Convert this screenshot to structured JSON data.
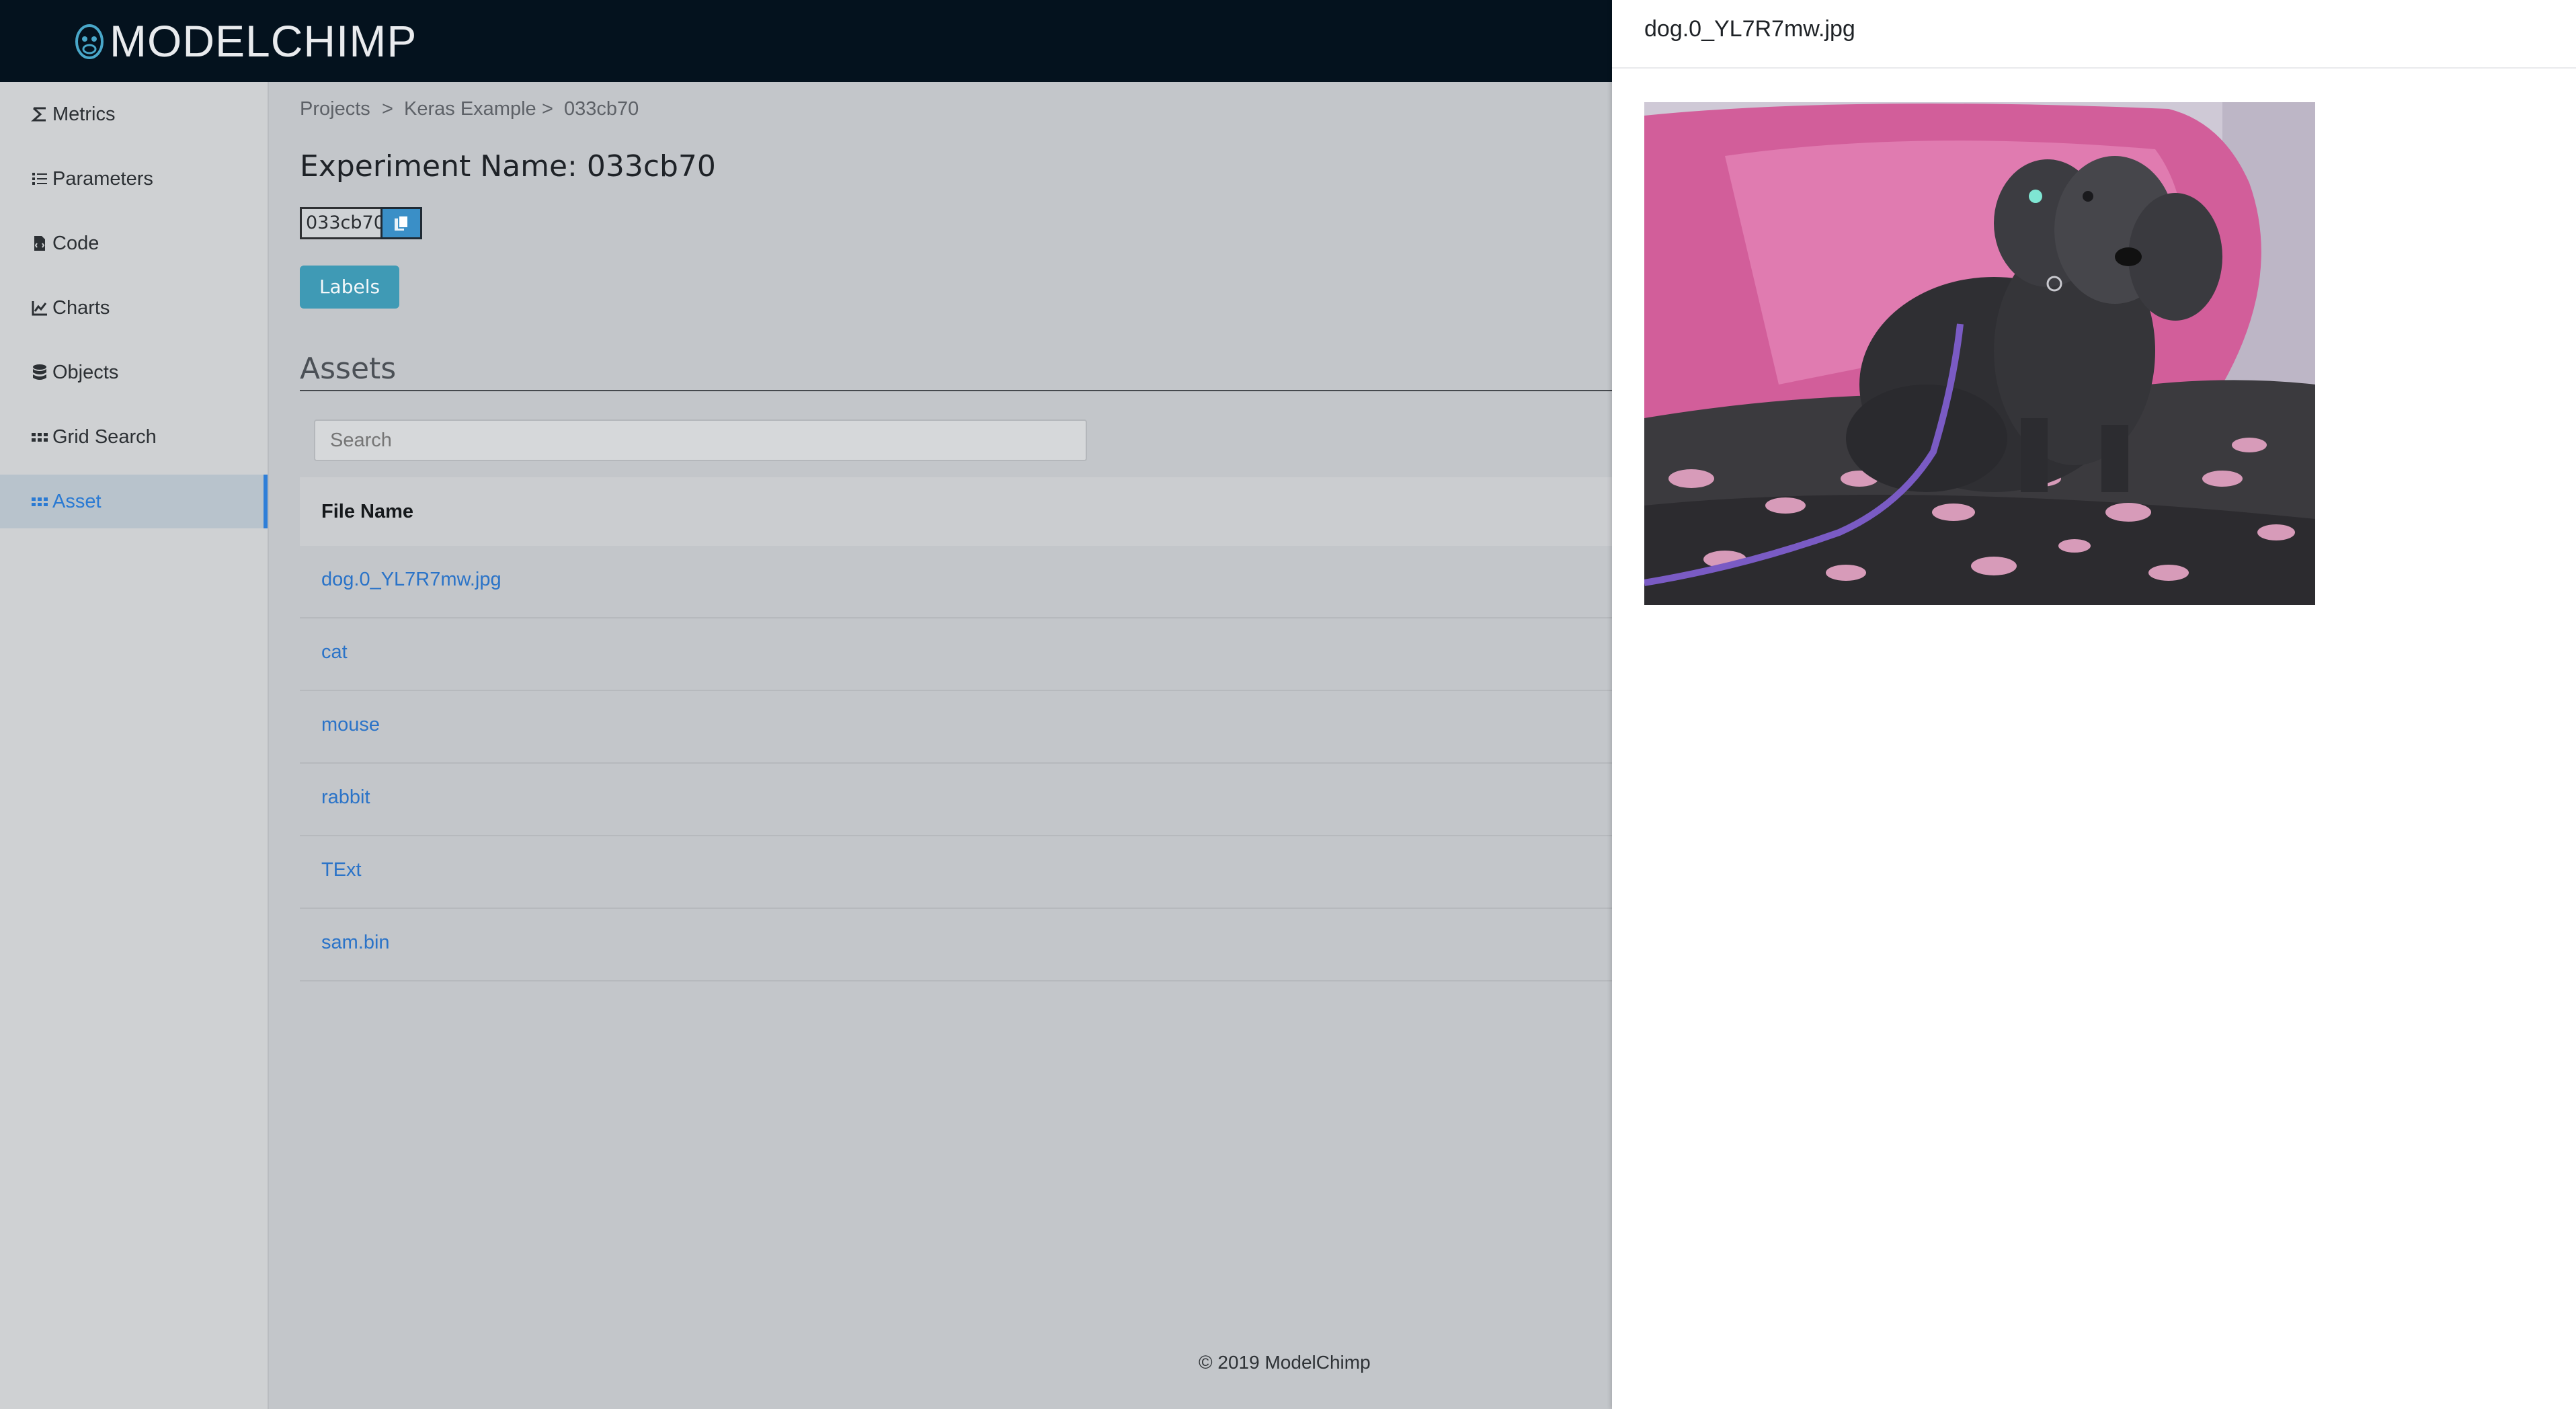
{
  "header": {
    "logo_text": "MODELCHIMP"
  },
  "sidebar": {
    "items": [
      {
        "label": "Metrics",
        "icon": "sigma-icon"
      },
      {
        "label": "Parameters",
        "icon": "list-icon"
      },
      {
        "label": "Code",
        "icon": "code-file-icon"
      },
      {
        "label": "Charts",
        "icon": "line-chart-icon"
      },
      {
        "label": "Objects",
        "icon": "database-icon"
      },
      {
        "label": "Grid Search",
        "icon": "grid-icon"
      },
      {
        "label": "Asset",
        "icon": "grid-icon",
        "active": true
      }
    ]
  },
  "breadcrumb": {
    "items": [
      "Projects",
      "Keras Example",
      "033cb70"
    ],
    "separator": ">"
  },
  "experiment": {
    "title": "Experiment Name: 033cb70",
    "id": "033cb70",
    "labels_button": "Labels"
  },
  "assets": {
    "title": "Assets",
    "search_placeholder": "Search",
    "column_header": "File Name",
    "files": [
      "dog.0_YL7R7mw.jpg",
      "cat",
      "mouse",
      "rabbit",
      "TExt",
      "sam.bin"
    ]
  },
  "footer": {
    "text": "© 2019 ModelChimp"
  },
  "drawer": {
    "title": "dog.0_YL7R7mw.jpg"
  },
  "colors": {
    "header_bg": "#04121e",
    "accent": "#2f7fd8",
    "labels_button": "#3f9ab5",
    "link": "#2a73c8"
  }
}
